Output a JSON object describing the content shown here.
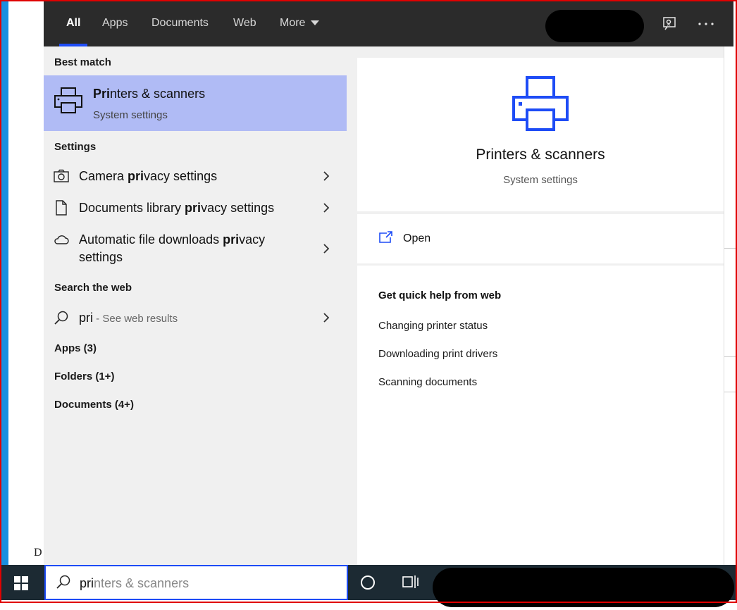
{
  "tabs": [
    {
      "label": "All",
      "active": true
    },
    {
      "label": "Apps",
      "active": false
    },
    {
      "label": "Documents",
      "active": false
    },
    {
      "label": "Web",
      "active": false
    },
    {
      "label": "More",
      "active": false
    }
  ],
  "top_icons": [
    "feedback-icon",
    "more-options-icon"
  ],
  "best_match": {
    "heading": "Best match",
    "title_bold": "Pri",
    "title_rest": "nters & scanners",
    "subtitle": "System settings",
    "icon": "printer-icon"
  },
  "settings": {
    "heading": "Settings",
    "items": [
      {
        "pre": "Camera ",
        "bold": "pri",
        "post": "vacy settings",
        "icon": "camera-icon"
      },
      {
        "pre": "Documents library ",
        "bold": "pri",
        "post": "vacy settings",
        "icon": "document-icon"
      },
      {
        "pre": "Automatic file downloads ",
        "bold": "pri",
        "post": "vacy",
        "line2": "settings",
        "icon": "cloud-icon"
      }
    ]
  },
  "web": {
    "heading": "Search the web",
    "query": "pri",
    "suffix": " - See web results",
    "icon": "search-icon"
  },
  "groups": [
    "Apps (3)",
    "Folders (1+)",
    "Documents (4+)"
  ],
  "preview": {
    "title": "Printers & scanners",
    "subtitle": "System settings",
    "open_label": "Open",
    "help_heading": "Get quick help from web",
    "help_links": [
      "Changing printer status",
      "Downloading print drivers",
      "Scanning documents"
    ]
  },
  "taskbar": {
    "search_typed": "pri",
    "search_suggest": "nters & scanners"
  },
  "colors": {
    "accent": "#1e4cf6",
    "highlight": "#b0bbf5",
    "topbar": "#2b2b2b",
    "pane": "#f0f0f0",
    "taskbar": "#1c2a33"
  },
  "background": {
    "desktop_letter": "D"
  }
}
